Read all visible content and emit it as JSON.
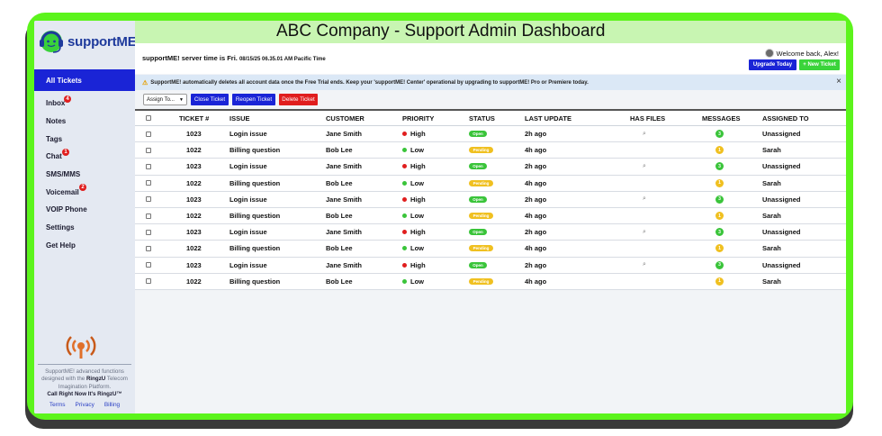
{
  "app": {
    "brand": "supportME!",
    "title": "ABC Company - Support Admin Dashboard"
  },
  "sidebar": {
    "items": [
      {
        "label": "All Tickets",
        "active": true,
        "badge": ""
      },
      {
        "label": "Inbox",
        "badge": "4"
      },
      {
        "label": "Notes",
        "badge": ""
      },
      {
        "label": "Tags",
        "badge": ""
      },
      {
        "label": "Chat",
        "badge": "1"
      },
      {
        "label": "SMS/MMS",
        "badge": ""
      },
      {
        "label": "Voicemail",
        "badge": "2"
      },
      {
        "label": "VOIP Phone",
        "badge": ""
      },
      {
        "label": "Settings",
        "badge": ""
      },
      {
        "label": "Get Help",
        "badge": ""
      }
    ],
    "footer": {
      "line1": "SupportME! advanced functions",
      "line2_pre": "designed with the ",
      "line2_brand": "RingzU",
      "line2_post": " Telecom",
      "line3": "Imagination Platform.",
      "tagline": "Call Right Now It's RingzU™"
    },
    "links": [
      "Terms",
      "Privacy",
      "Billing"
    ]
  },
  "header": {
    "server_time_label": "supportME! server time is Fri. ",
    "server_date": "08/15/25",
    "server_time": " 06.35.01 AM Pacific Time",
    "welcome": "Welcome back, Alex!",
    "upgrade_label": "Upgrade Today",
    "new_ticket_label": "+ New Ticket"
  },
  "notice": {
    "icon": "warning-icon",
    "text": "SupportME! automatically deletes all account data once the Free Trial ends. Keep your 'supportME! Center' operational by upgrading to supportME! Pro or Premiere today.",
    "close": "×"
  },
  "actions": {
    "assign_placeholder": "Assign To...",
    "close_label": "Close Ticket",
    "reopen_label": "Reopen Ticket",
    "delete_label": "Delete Ticket"
  },
  "table": {
    "columns": [
      "TICKET #",
      "ISSUE",
      "CUSTOMER",
      "PRIORITY",
      "STATUS",
      "LAST UPDATE",
      "HAS FILES",
      "MESSAGES",
      "ASSIGNED TO"
    ],
    "rows": [
      {
        "ticket": "1023",
        "issue": "Login issue",
        "customer": "Jane Smith",
        "priority": "High",
        "status": "Open",
        "updated": "2h ago",
        "files": true,
        "messages": "3",
        "assigned": "Unassigned"
      },
      {
        "ticket": "1022",
        "issue": "Billing question",
        "customer": "Bob Lee",
        "priority": "Low",
        "status": "Pending",
        "updated": "4h ago",
        "files": false,
        "messages": "1",
        "assigned": "Sarah"
      },
      {
        "ticket": "1023",
        "issue": "Login issue",
        "customer": "Jane Smith",
        "priority": "High",
        "status": "Open",
        "updated": "2h ago",
        "files": true,
        "messages": "3",
        "assigned": "Unassigned"
      },
      {
        "ticket": "1022",
        "issue": "Billing question",
        "customer": "Bob Lee",
        "priority": "Low",
        "status": "Pending",
        "updated": "4h ago",
        "files": false,
        "messages": "1",
        "assigned": "Sarah"
      },
      {
        "ticket": "1023",
        "issue": "Login issue",
        "customer": "Jane Smith",
        "priority": "High",
        "status": "Open",
        "updated": "2h ago",
        "files": true,
        "messages": "3",
        "assigned": "Unassigned"
      },
      {
        "ticket": "1022",
        "issue": "Billing question",
        "customer": "Bob Lee",
        "priority": "Low",
        "status": "Pending",
        "updated": "4h ago",
        "files": false,
        "messages": "1",
        "assigned": "Sarah"
      },
      {
        "ticket": "1023",
        "issue": "Login issue",
        "customer": "Jane Smith",
        "priority": "High",
        "status": "Open",
        "updated": "2h ago",
        "files": true,
        "messages": "3",
        "assigned": "Unassigned"
      },
      {
        "ticket": "1022",
        "issue": "Billing question",
        "customer": "Bob Lee",
        "priority": "Low",
        "status": "Pending",
        "updated": "4h ago",
        "files": false,
        "messages": "1",
        "assigned": "Sarah"
      },
      {
        "ticket": "1023",
        "issue": "Login issue",
        "customer": "Jane Smith",
        "priority": "High",
        "status": "Open",
        "updated": "2h ago",
        "files": true,
        "messages": "3",
        "assigned": "Unassigned"
      },
      {
        "ticket": "1022",
        "issue": "Billing question",
        "customer": "Bob Lee",
        "priority": "Low",
        "status": "Pending",
        "updated": "4h ago",
        "files": false,
        "messages": "1",
        "assigned": "Sarah"
      }
    ]
  },
  "colors": {
    "frame_green": "#5cf41c",
    "title_green": "#c8f5b2",
    "primary_blue": "#1a24d6",
    "danger_red": "#e01e1e",
    "success_green": "#3ac43a",
    "pending_yellow": "#f0c020",
    "sidebar_bg": "#e4e9f2"
  }
}
